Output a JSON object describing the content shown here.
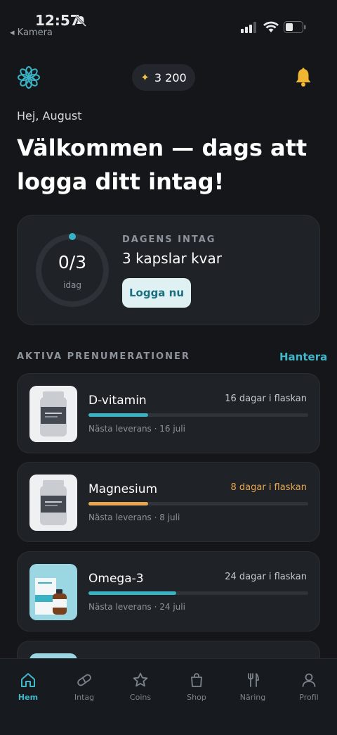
{
  "status_bar": {
    "time": "12:57",
    "back_label": "◂ Kamera"
  },
  "header": {
    "coins": "3 200"
  },
  "greeting": "Hej, August",
  "headline": "Välkommen — dags att logga ditt intag!",
  "intake": {
    "ring_value": "0/3",
    "ring_label": "idag",
    "progress_fraction": 0,
    "kicker": "DAGENS INTAG",
    "title": "3 kapslar kvar",
    "button_label": "Logga nu"
  },
  "subscriptions": {
    "title": "AKTIVA PRENUMERATIONER",
    "manage_label": "Hantera",
    "items": [
      {
        "name": "D-vitamin",
        "days": "16 dagar i flaskan",
        "next": "Nästa leverans · 16 juli",
        "progress": 0.27,
        "warning": false
      },
      {
        "name": "Magnesium",
        "days": "8 dagar i flaskan",
        "next": "Nästa leverans · 8 juli",
        "progress": 0.27,
        "warning": true
      },
      {
        "name": "Omega-3",
        "days": "24 dagar i flaskan",
        "next": "Nästa leverans · 24 juli",
        "progress": 0.4,
        "warning": false
      }
    ]
  },
  "tabs": [
    {
      "label": "Hem",
      "icon": "home-icon",
      "active": true
    },
    {
      "label": "Intag",
      "icon": "capsule-icon",
      "active": false
    },
    {
      "label": "Coins",
      "icon": "star-icon",
      "active": false
    },
    {
      "label": "Shop",
      "icon": "shopping-bag-icon",
      "active": false
    },
    {
      "label": "Näring",
      "icon": "fork-knife-icon",
      "active": false
    },
    {
      "label": "Profil",
      "icon": "person-icon",
      "active": false
    }
  ],
  "colors": {
    "background": "#141619",
    "card": "#1f2328",
    "accent": "#41b8c9",
    "warning": "#e7a64f",
    "gold": "#f0c04a"
  }
}
